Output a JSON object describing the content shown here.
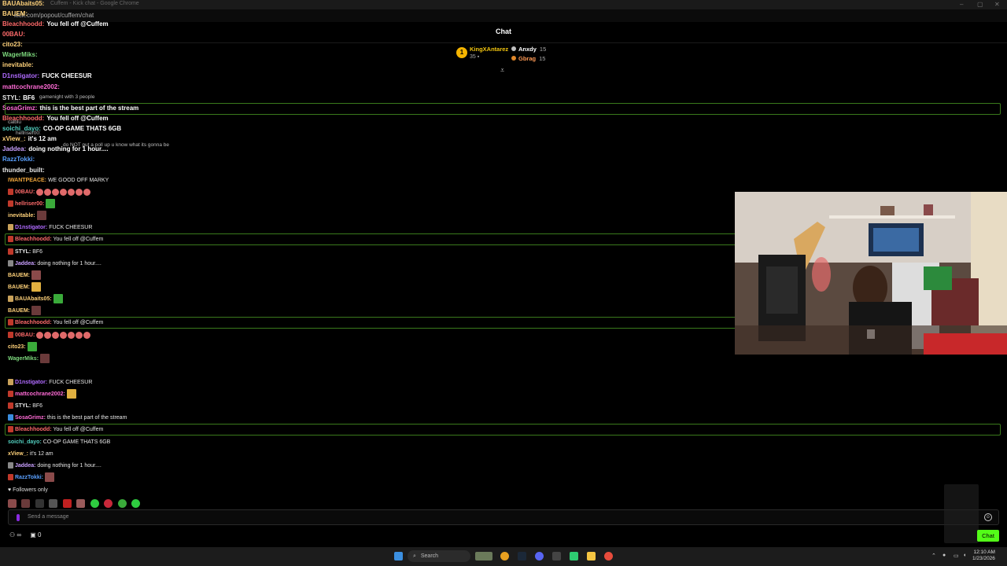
{
  "window": {
    "title": "Cuffem - Kick chat - Google Chrome",
    "url": "kick.com/popout/cuffem/chat"
  },
  "header": {
    "title": "Chat"
  },
  "gifters": {
    "top": {
      "rank": "1",
      "name": "KingXAntarez",
      "count": "35"
    },
    "others": [
      {
        "name": "Anxdy",
        "count": "15"
      },
      {
        "name": "Gbrag",
        "count": "15"
      }
    ]
  },
  "ghost_overlay": [
    {
      "user": "BAUAbaits05:",
      "text": ""
    },
    {
      "user": "BAUEM:",
      "text": ""
    },
    {
      "user": "Bleachhoodd:",
      "text": "You fell off @Cuffem"
    },
    {
      "user": "00BAU:",
      "text": ""
    },
    {
      "user": "cito23:",
      "text": ""
    },
    {
      "user": "WagerMiks:",
      "text": ""
    },
    {
      "user": "inevitable:",
      "text": ""
    },
    {
      "user": "D1nstigator:",
      "text": "FUCK CHEESUR"
    },
    {
      "user": "mattcochrane2002:",
      "text": ""
    },
    {
      "user": "STYL:",
      "text": "BF6"
    },
    {
      "user": "SosaGrimz:",
      "text": "this is the best part of the stream"
    },
    {
      "user": "Bleachhoodd:",
      "text": "You fell off @Cuffem"
    },
    {
      "user": "soichi_dayo:",
      "text": "CO-OP GAME THATS 6GB"
    },
    {
      "user": "xView_:",
      "text": "it's 12 am"
    },
    {
      "user": "Jaddea:",
      "text": "doing nothing for 1 hour...."
    },
    {
      "user": "RazzTokki:",
      "text": ""
    },
    {
      "user": "thunder_built:",
      "text": ""
    }
  ],
  "ghost_faint": [
    "gamenight with 3 people",
    "do NOT put a poll up u know what its gonna be",
    "hellriser00:",
    "calblu"
  ],
  "messages": [
    {
      "user": "IWANTPEACE:",
      "text": "WE GOOD OFF MARKY",
      "color": "#f0a63c",
      "emotes": 0
    },
    {
      "user": "00BAU:",
      "text": "",
      "color": "#ff6b6b",
      "emotes": 7,
      "badge": "#c0392b"
    },
    {
      "user": "hellriser00:",
      "text": "",
      "color": "#ff6b6b",
      "emotes": 1,
      "badge": "#c0392b"
    },
    {
      "user": "inevitable:",
      "text": "",
      "color": "#ffd27a",
      "emotes": 1
    },
    {
      "user": "D1nstigator:",
      "text": "FUCK CHEESUR",
      "color": "#b06bff",
      "badge": "#c9a25a"
    },
    {
      "user": "Bleachhoodd:",
      "text": "You fell off @Cuffem",
      "color": "#ff6b6b",
      "badge": "#c0392b",
      "highlight": true
    },
    {
      "user": "STYL:",
      "text": "BF6",
      "color": "#e8e8e8",
      "badge": "#c0392b"
    },
    {
      "user": "Jaddea:",
      "text": "doing nothing for 1 hour....",
      "color": "#c9a0ff",
      "badge": "#888"
    },
    {
      "user": "BAUEM:",
      "text": "",
      "color": "#ffd27a",
      "emotes": 1
    },
    {
      "user": "BAUEM:",
      "text": "",
      "color": "#ffd27a",
      "emotes": 1
    },
    {
      "user": "BAUAbaits05:",
      "text": "",
      "color": "#ffd27a",
      "emotes": 1,
      "badge": "#c9a25a"
    },
    {
      "user": "BAUEM:",
      "text": "",
      "color": "#ffd27a",
      "emotes": 1
    },
    {
      "user": "Bleachhoodd:",
      "text": "You fell off @Cuffem",
      "color": "#ff6b6b",
      "badge": "#c0392b",
      "highlight": true
    },
    {
      "user": "00BAU:",
      "text": "",
      "color": "#ff6b6b",
      "emotes": 7,
      "badge": "#c0392b"
    },
    {
      "user": "cito23:",
      "text": "",
      "color": "#ffd27a",
      "emotes": 1
    },
    {
      "user": "WagerMiks:",
      "text": "",
      "color": "#7dd97d",
      "emotes": 1
    },
    {
      "user": "D1nstigator:",
      "text": "FUCK CHEESUR",
      "color": "#b06bff",
      "badge": "#c9a25a"
    },
    {
      "user": "mattcochrane2002:",
      "text": "",
      "color": "#ff6bd6",
      "emotes": 1,
      "badge": "#c0392b"
    },
    {
      "user": "STYL:",
      "text": "BF6",
      "color": "#e8e8e8",
      "badge": "#c0392b"
    },
    {
      "user": "SosaGrimz:",
      "text": "this is the best part of the stream",
      "color": "#ff6bd6",
      "badge": "#3a8dde"
    },
    {
      "user": "Bleachhoodd:",
      "text": "You fell off @Cuffem",
      "color": "#ff6b6b",
      "badge": "#c0392b",
      "highlight": true
    },
    {
      "user": "soichi_dayo:",
      "text": "CO-OP GAME THATS 6GB",
      "color": "#53d0c0"
    },
    {
      "user": "xView_:",
      "text": "it's 12 am",
      "color": "#ffd27a"
    },
    {
      "user": "Jaddea:",
      "text": "doing nothing for 1 hour....",
      "color": "#c9a0ff",
      "badge": "#888"
    },
    {
      "user": "RazzTokki:",
      "text": "",
      "color": "#5aa0ff",
      "emotes": 1,
      "badge": "#c0392b"
    }
  ],
  "footer": {
    "followers_only": "Followers only",
    "input_placeholder": "Send a message",
    "infinity": "∞",
    "gift_count": "0",
    "chat_button": "Chat"
  },
  "taskbar": {
    "search": "Search",
    "time": "12:10 AM",
    "date": "1/23/2026"
  },
  "colors": {
    "accent": "#53fc18",
    "highlight_border": "#3a7a1c"
  }
}
